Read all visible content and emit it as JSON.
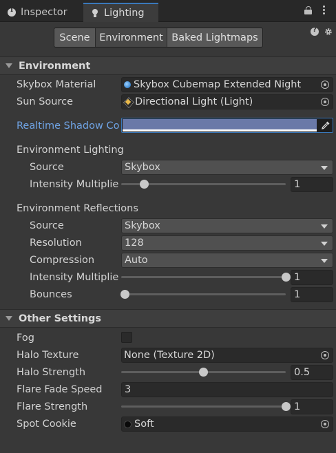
{
  "tabs": [
    {
      "label": "Inspector",
      "icon": "info-icon"
    },
    {
      "label": "Lighting",
      "icon": "lightbulb-icon"
    }
  ],
  "toolbar": {
    "segments": [
      "Scene",
      "Environment",
      "Baked Lightmaps"
    ],
    "selected": "Environment"
  },
  "environment": {
    "header": "Environment",
    "skybox_material": {
      "label": "Skybox Material",
      "value": "Skybox Cubemap Extended Night"
    },
    "sun_source": {
      "label": "Sun Source",
      "value": "Directional Light (Light)"
    },
    "realtime_shadow_color": {
      "label": "Realtime Shadow Co",
      "color": "#6a79a8"
    },
    "lighting": {
      "title": "Environment Lighting",
      "source": {
        "label": "Source",
        "value": "Skybox"
      },
      "intensity": {
        "label": "Intensity Multiplier",
        "value": "1",
        "fraction": 0.14
      }
    },
    "reflections": {
      "title": "Environment Reflections",
      "source": {
        "label": "Source",
        "value": "Skybox"
      },
      "resolution": {
        "label": "Resolution",
        "value": "128"
      },
      "compression": {
        "label": "Compression",
        "value": "Auto"
      },
      "intensity": {
        "label": "Intensity Multiplier",
        "value": "1",
        "fraction": 1.0
      },
      "bounces": {
        "label": "Bounces",
        "value": "1",
        "fraction": 0.0
      }
    }
  },
  "other": {
    "header": "Other Settings",
    "fog": {
      "label": "Fog",
      "checked": false
    },
    "halo_texture": {
      "label": "Halo Texture",
      "value": "None (Texture 2D)"
    },
    "halo_strength": {
      "label": "Halo Strength",
      "value": "0.5",
      "fraction": 0.5
    },
    "flare_fade_speed": {
      "label": "Flare Fade Speed",
      "value": "3"
    },
    "flare_strength": {
      "label": "Flare Strength",
      "value": "1",
      "fraction": 1.0
    },
    "spot_cookie": {
      "label": "Spot Cookie",
      "value": "Soft"
    }
  },
  "colors": {
    "accent": "#3a79bb",
    "link_label": "#6fa3e4",
    "panel_bg": "#383838"
  }
}
